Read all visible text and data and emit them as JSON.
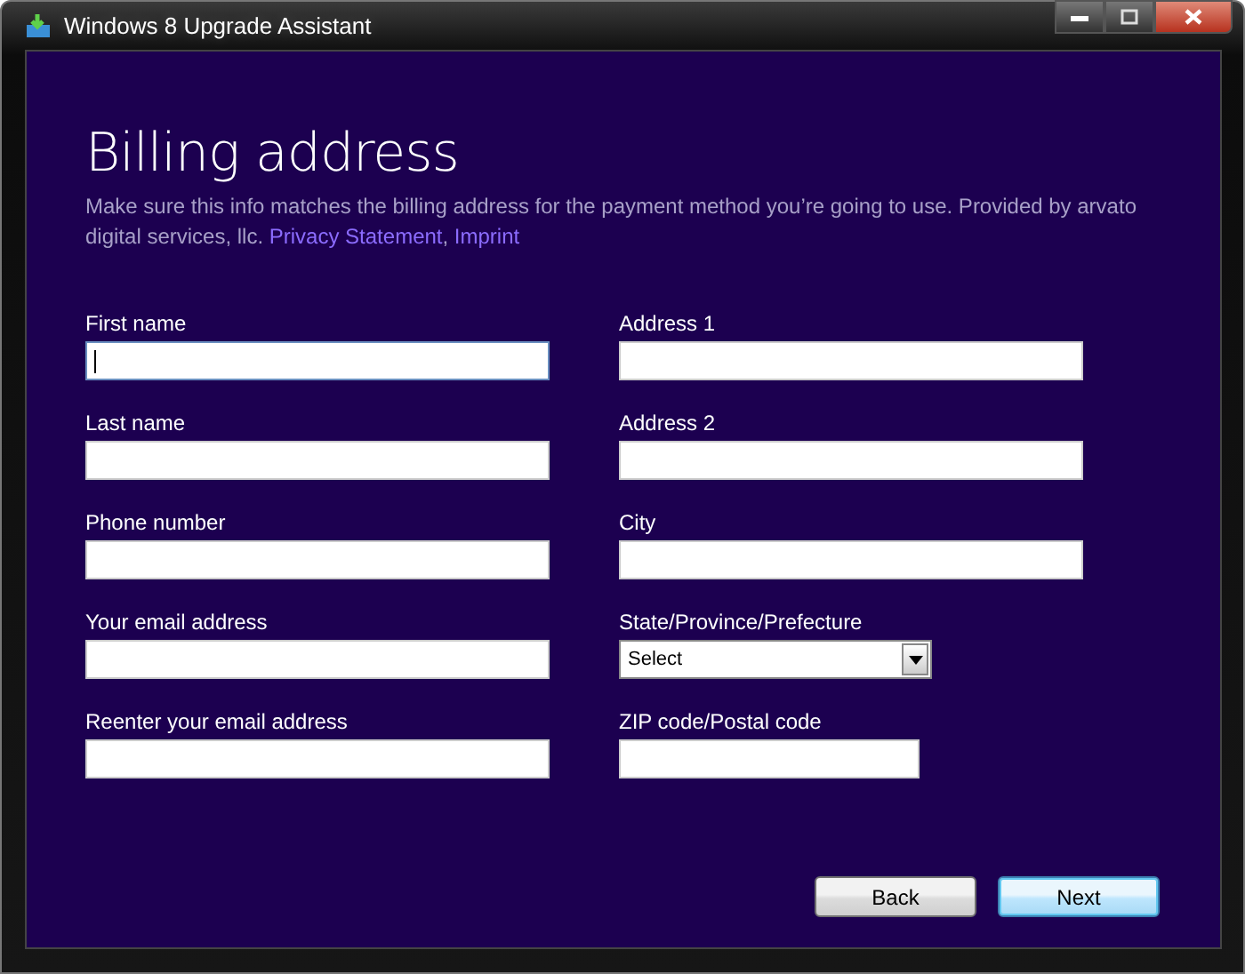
{
  "window": {
    "title": "Windows 8 Upgrade Assistant"
  },
  "heading": "Billing address",
  "description": {
    "text": "Make sure this info matches the billing address for the payment method you’re going to use. Provided by arvato digital services, llc.",
    "links": [
      {
        "label": "Privacy Statement"
      },
      {
        "label": "Imprint"
      }
    ],
    "separator": ","
  },
  "columns": [
    {
      "fields": [
        {
          "label": "First name",
          "kind": "text",
          "focused": true
        },
        {
          "label": "Last name",
          "kind": "text",
          "focused": false
        },
        {
          "label": "Phone number",
          "kind": "text",
          "focused": false
        },
        {
          "label": "Your email address",
          "kind": "text",
          "focused": false
        },
        {
          "label": "Reenter your email address",
          "kind": "text",
          "focused": false
        }
      ]
    },
    {
      "fields": [
        {
          "label": "Address 1",
          "kind": "text",
          "focused": false
        },
        {
          "label": "Address 2",
          "kind": "text",
          "focused": false
        },
        {
          "label": "City",
          "kind": "text",
          "focused": false
        },
        {
          "label": "State/Province/Prefecture",
          "kind": "select",
          "value": "Select",
          "focused": false
        },
        {
          "label": "ZIP code/Postal code",
          "kind": "short",
          "focused": false
        }
      ]
    }
  ],
  "buttons": [
    {
      "label": "Back",
      "default": false
    },
    {
      "label": "Next",
      "default": true
    }
  ]
}
